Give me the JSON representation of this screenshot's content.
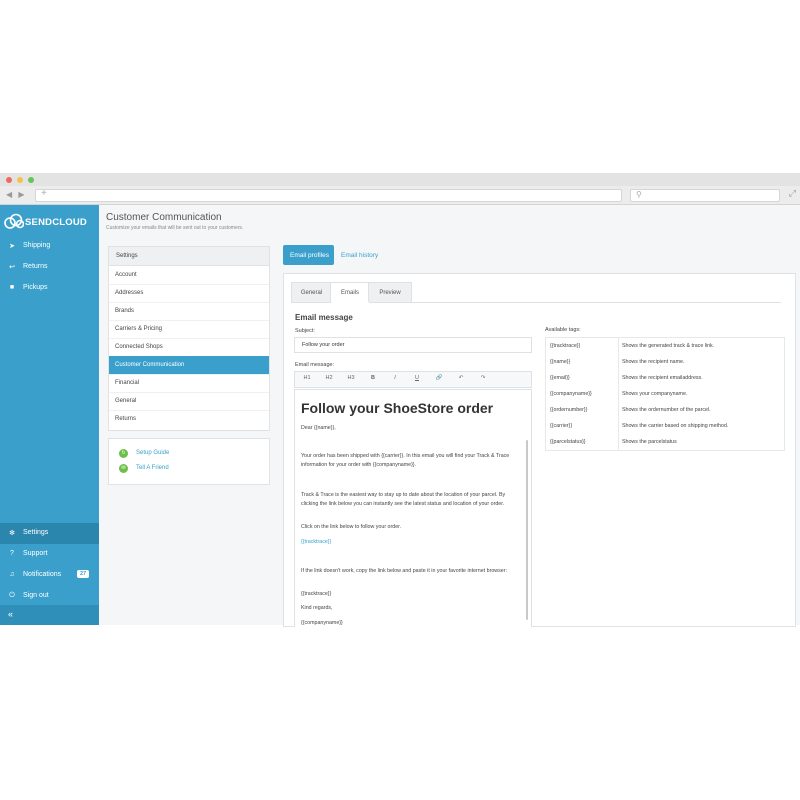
{
  "app": {
    "brand": "SENDCLOUD",
    "accent": "#3aa0cb"
  },
  "sidebar": {
    "items": [
      {
        "label": "Shipping",
        "icon": "paper-plane-icon"
      },
      {
        "label": "Returns",
        "icon": "return-icon"
      },
      {
        "label": "Pickups",
        "icon": "truck-icon"
      }
    ],
    "bottom_items": [
      {
        "label": "Settings",
        "icon": "gear-icon"
      },
      {
        "label": "Support",
        "icon": "question-icon"
      },
      {
        "label": "Notifications",
        "icon": "bell-icon",
        "badge": "27"
      },
      {
        "label": "Sign out",
        "icon": "power-icon"
      }
    ],
    "collapse_icon": "«"
  },
  "header": {
    "title": "Customer Communication",
    "subtitle": "Customize your emails that will be sent out to your customers."
  },
  "settings_panel": {
    "heading": "Settings",
    "items": [
      "Account",
      "Addresses",
      "Brands",
      "Carriers & Pricing",
      "Connected Shops",
      "Customer Communication",
      "Financial",
      "General",
      "Returns"
    ],
    "active_index": 5
  },
  "links": [
    {
      "label": "Setup Guide",
      "icon": "guide-icon"
    },
    {
      "label": "Tell A Friend",
      "icon": "friend-icon"
    }
  ],
  "top_tabs": [
    "Email profiles",
    "Email history"
  ],
  "sub_tabs": [
    "General",
    "Emails",
    "Preview"
  ],
  "email": {
    "section_title": "Email message",
    "subject_label": "Subject:",
    "subject_value": "Follow your order",
    "message_label": "Email message:",
    "toolbar": [
      "H1",
      "H2",
      "H3",
      "B",
      "I",
      "U",
      "🔗",
      "↶",
      "↷"
    ],
    "heading": "Follow your ShoeStore order",
    "p1": "Dear {{name}},",
    "p2": "Your order has been shipped with {{carrier}}. In this email you will find your Track & Trace information for your order with {{companyname}}.",
    "p3": "Track & Trace is the easiest way to stay up to date about the location of your parcel. By clicking the link below you can instantly see the latest status and location of your order.",
    "p4": "Click on the link below to follow your order.",
    "p5": "{{tracktrace}}",
    "p6": "If the link doesn't work, copy the link below and paste it in your favorite internet browser:",
    "p7": "{{tracktrace}}",
    "p8": "Kind regards,",
    "p9": "{{companyname}}"
  },
  "tags": {
    "label": "Available tags:",
    "rows": [
      {
        "tag": "{{tracktrace}}",
        "desc": "Shows the generated track & trace link."
      },
      {
        "tag": "{{name}}",
        "desc": "Shows the recipient name."
      },
      {
        "tag": "{{email}}",
        "desc": "Shows the recipient emailaddress."
      },
      {
        "tag": "{{companyname}}",
        "desc": "Shows your companyname."
      },
      {
        "tag": "{{ordernumber}}",
        "desc": "Shows the ordernumber of the parcel."
      },
      {
        "tag": "{{carrier}}",
        "desc": "Shows the carrier based on shipping method."
      },
      {
        "tag": "{{parcelstatus}}",
        "desc": "Shows the parcelstatus"
      }
    ]
  }
}
